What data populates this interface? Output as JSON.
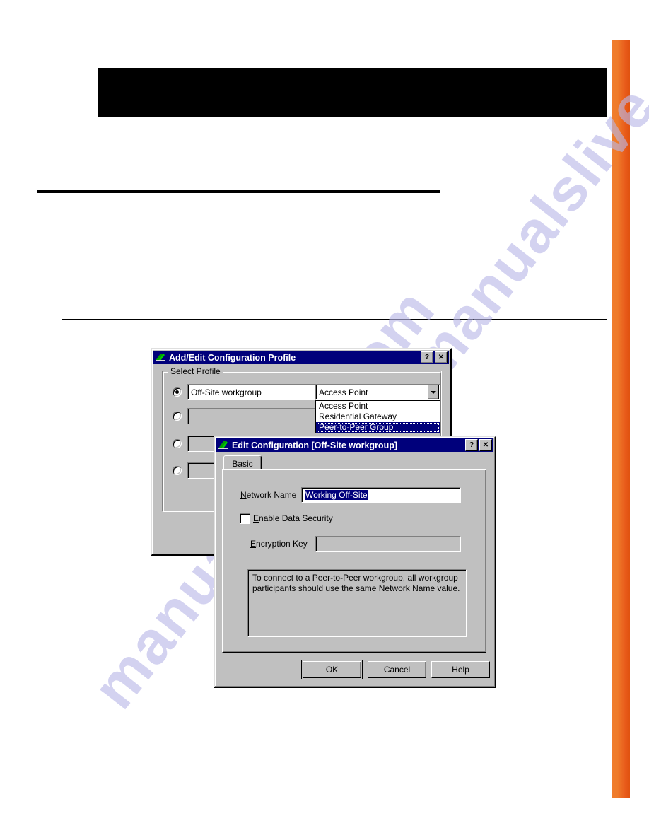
{
  "page": {
    "watermark_text": "manualslive.com",
    "accent_color": "#ef7b2a",
    "redacted_header": "",
    "rule_color": "#000000"
  },
  "dialog1": {
    "title": "Add/Edit Configuration Profile",
    "icon": "wireless-card-icon",
    "titlebar_buttons": [
      {
        "name": "help-button",
        "label": "?"
      },
      {
        "name": "close-button",
        "label": "✕"
      }
    ],
    "groupbox_label": "Select Profile",
    "profiles": [
      {
        "selected": true,
        "name": "Off-Site workgroup"
      },
      {
        "selected": false,
        "name": ""
      },
      {
        "selected": false,
        "name": ""
      },
      {
        "selected": false,
        "name": ""
      }
    ],
    "network_type_combo": {
      "value": "Access Point",
      "expanded": true,
      "options": [
        {
          "label": "Access Point",
          "selected": false
        },
        {
          "label": "Residential Gateway",
          "selected": false
        },
        {
          "label": "Peer-to-Peer Group",
          "selected": true
        }
      ]
    }
  },
  "dialog2": {
    "title": "Edit Configuration [Off-Site workgroup]",
    "icon": "wireless-card-icon",
    "titlebar_buttons": [
      {
        "name": "help-button",
        "label": "?"
      },
      {
        "name": "close-button",
        "label": "✕"
      }
    ],
    "tabs": [
      {
        "label": "Basic",
        "active": true
      }
    ],
    "network_name": {
      "label": "Network Name",
      "accelerator": "N",
      "value": "Working Off-Site",
      "selected": true
    },
    "enable_data_security": {
      "label": "Enable Data Security",
      "accelerator": "E",
      "checked": false
    },
    "encryption_key": {
      "label": "Encryption Key",
      "accelerator": "E",
      "value": "",
      "disabled": true,
      "mask_glyphs": "∙∙∙∙∙∙∙∙∙∙∙∙∙∙∙∙∙∙∙∙∙∙∙∙∙∙∙∙∙∙∙∙∙∙∙∙∙∙∙∙∙∙∙∙∙∙∙∙∙∙"
    },
    "info_text": "To connect to a Peer-to-Peer workgroup, all workgroup participants should use the same Network Name value.",
    "buttons": [
      {
        "name": "ok-button",
        "label": "OK",
        "default": true
      },
      {
        "name": "cancel-button",
        "label": "Cancel",
        "default": false
      },
      {
        "name": "help-button",
        "label": "Help",
        "default": false
      }
    ]
  }
}
